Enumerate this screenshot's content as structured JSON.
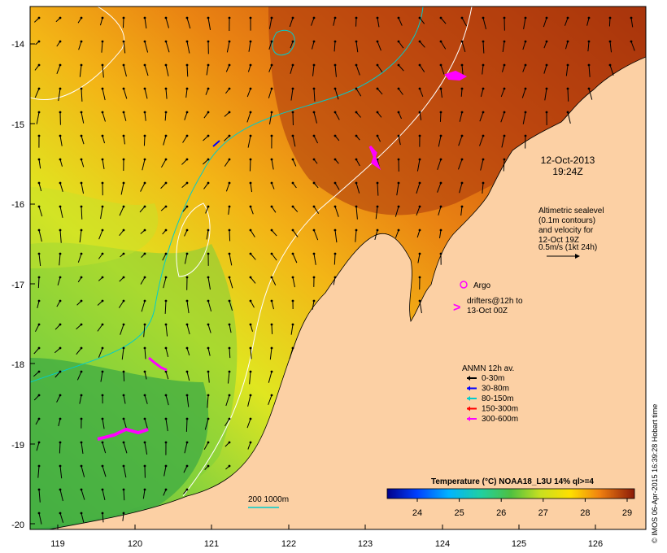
{
  "map": {
    "y_ticks": [
      "-14",
      "-15",
      "-16",
      "-17",
      "-18",
      "-19",
      "-20"
    ],
    "x_ticks": [
      "119",
      "120",
      "121",
      "122",
      "123",
      "124",
      "125",
      "126"
    ],
    "date_line1": "12-Oct-2013",
    "date_line2": "19:24Z",
    "altimetric_lines": [
      "Altimetric sealevel",
      "(0.1m contours)",
      "and velocity for",
      "12-Oct 19Z",
      "0.5m/s (1kt 24h)"
    ],
    "argo_label": "Argo",
    "drifters_lines": [
      "drifters@12h to",
      "13-Oct 00Z"
    ],
    "anmn": {
      "title": "ANMN 12h av.",
      "entries": [
        {
          "label": "0-30m",
          "color": "#000000"
        },
        {
          "label": "30-80m",
          "color": "#0000ff"
        },
        {
          "label": "80-150m",
          "color": "#00cccc"
        },
        {
          "label": "150-300m",
          "color": "#ff0000"
        },
        {
          "label": "300-600m",
          "color": "#ff00ff"
        }
      ]
    },
    "isobath_label": "200  1000m",
    "colorbar": {
      "title": "Temperature (°C) NOAA18_L3U 14% ql>=4",
      "ticks": [
        "24",
        "25",
        "26",
        "27",
        "28",
        "29"
      ]
    },
    "credit": "© IMOS 06-Apr-2015 16:39:28 Hobart time",
    "colors": {
      "land": "#fcd0a4",
      "warm": "#b03a0c",
      "mid": "#f09a14",
      "cool": "#5fc04a",
      "drifter": "#ff00ff",
      "isobath": "#00cccc"
    }
  }
}
